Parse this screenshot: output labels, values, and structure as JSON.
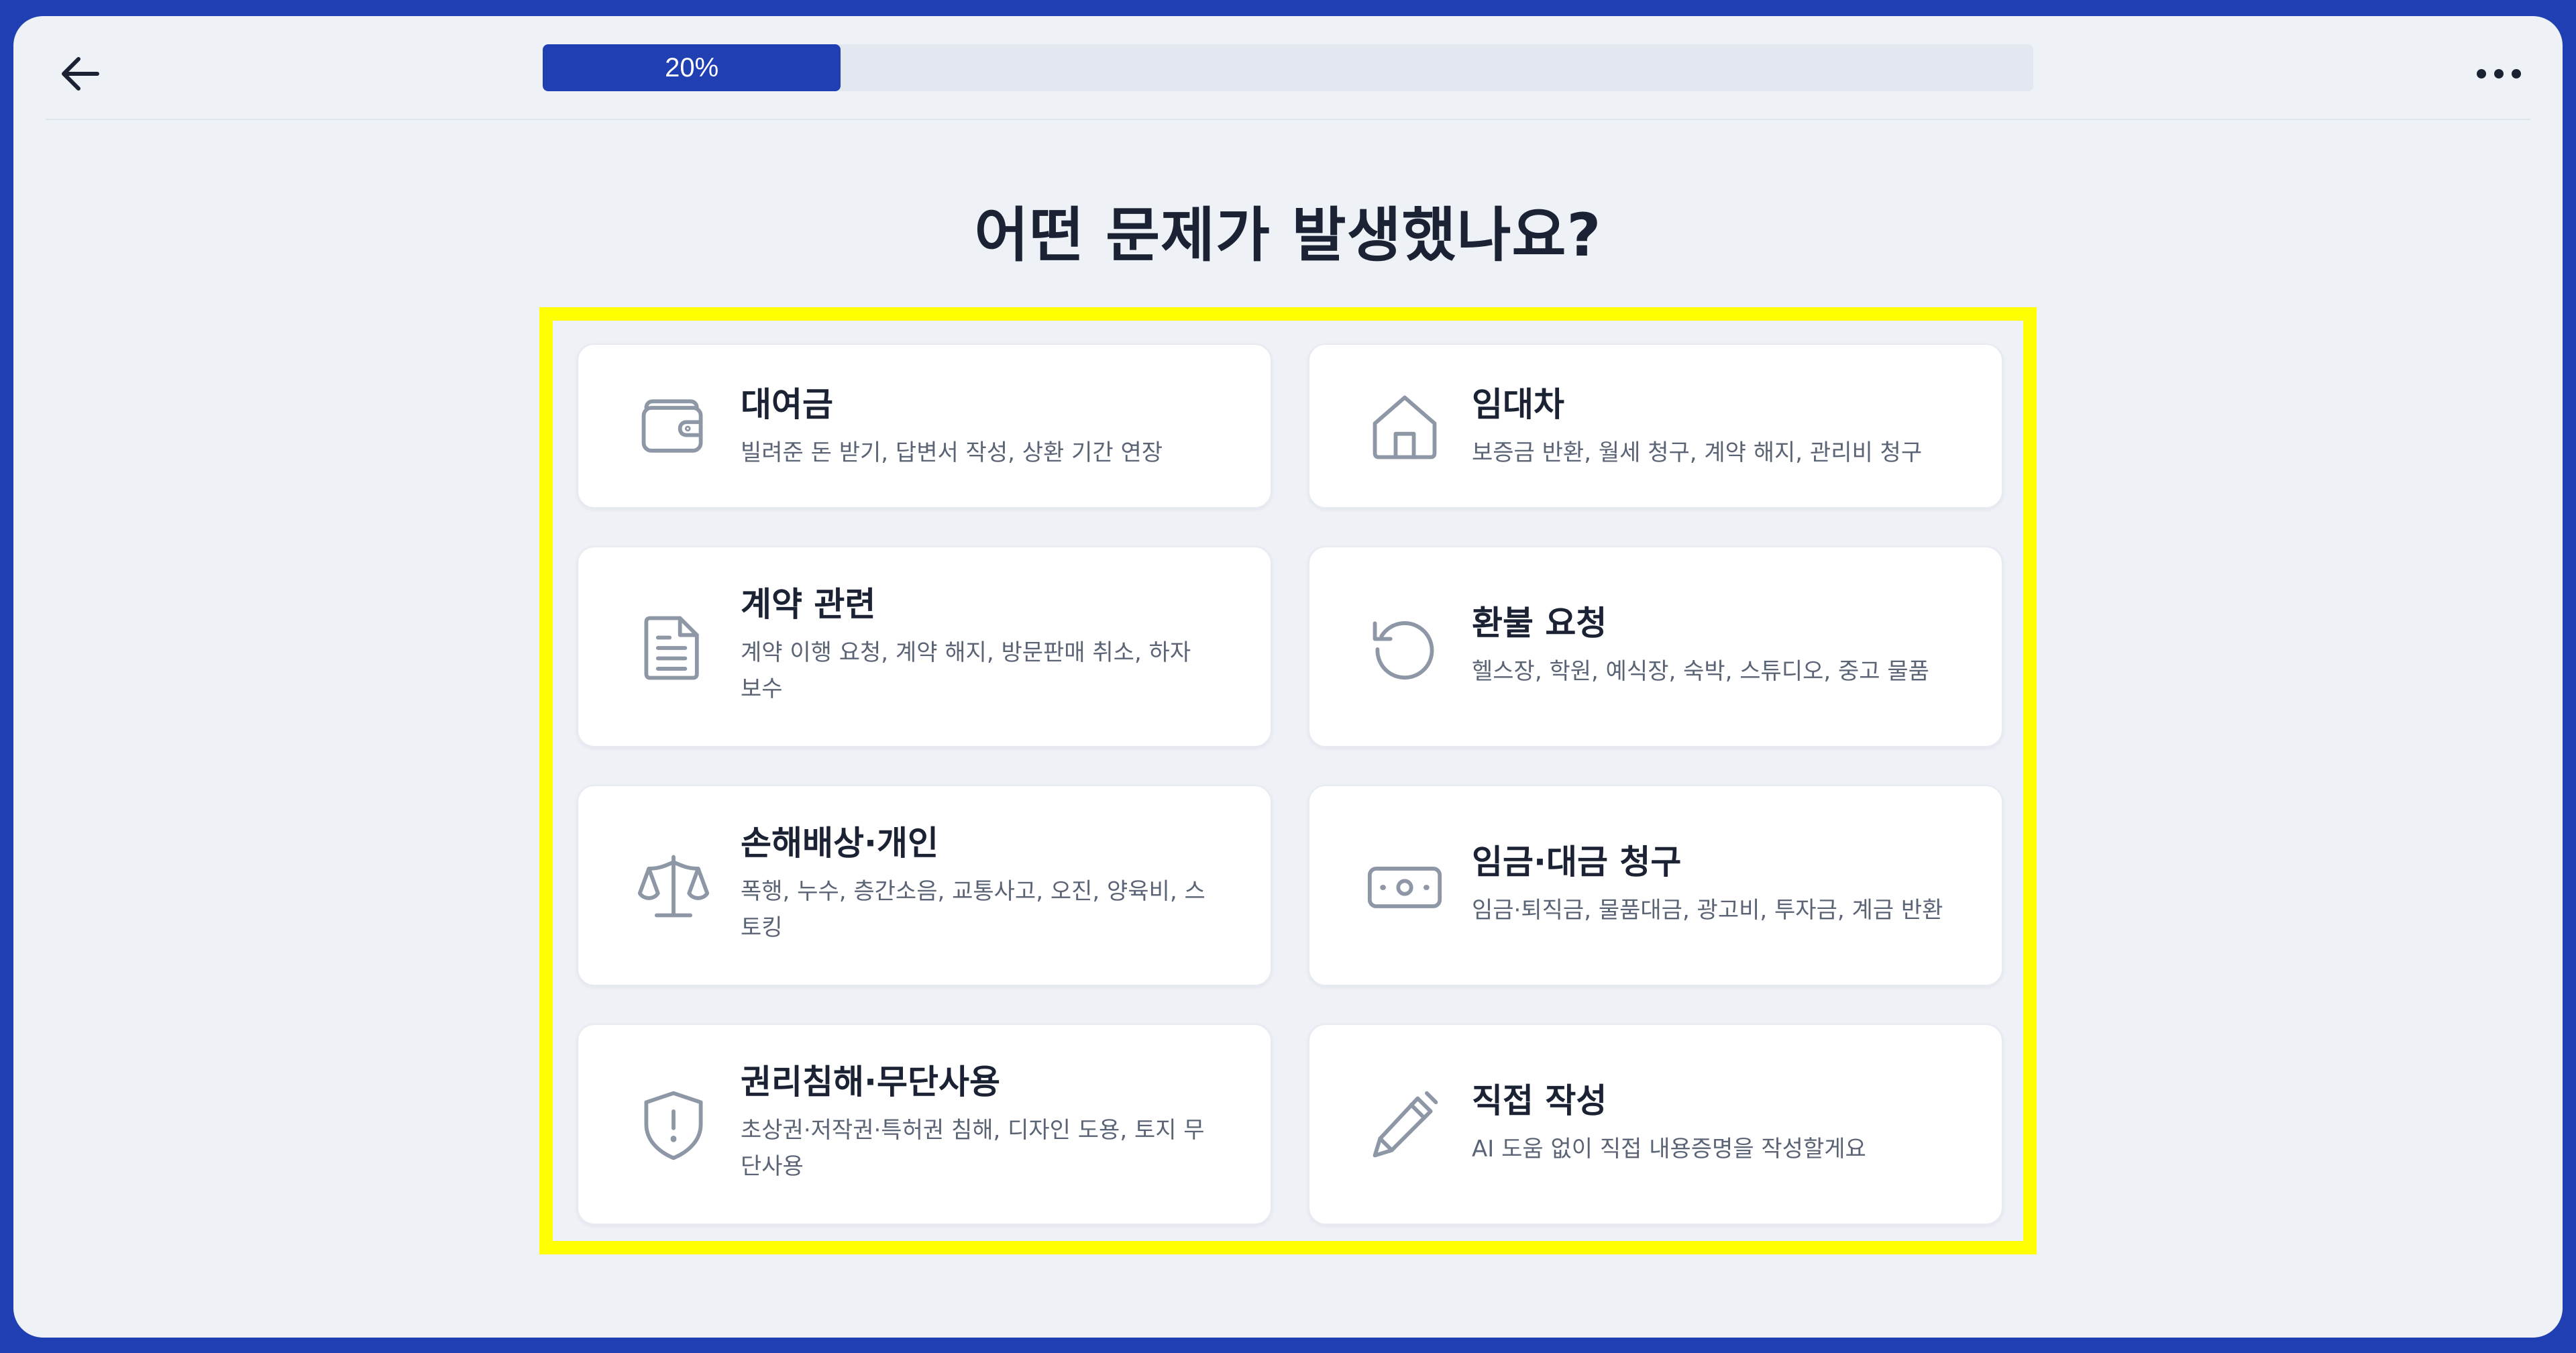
{
  "progress": {
    "label": "20%",
    "fraction": 0.2
  },
  "header": {
    "back_icon": "arrow-left-icon",
    "more_icon": "more-horizontal-icon"
  },
  "page": {
    "title": "어떤 문제가 발생했나요?"
  },
  "colors": {
    "accent": "#1f3fb2",
    "highlight_border": "#ffff00",
    "icon_stroke": "#8e97a6",
    "background": "#eef2f7"
  },
  "categories": [
    {
      "title": "대여금",
      "desc": "빌려준 돈 받기, 답변서 작성, 상환 기간 연장",
      "icon": "wallet-icon"
    },
    {
      "title": "임대차",
      "desc": "보증금 반환, 월세 청구, 계약 해지, 관리비 청구",
      "icon": "house-icon"
    },
    {
      "title": "계약 관련",
      "desc": "계약 이행 요청, 계약 해지, 방문판매 취소, 하자 보수",
      "icon": "document-icon"
    },
    {
      "title": "환불 요청",
      "desc": "헬스장, 학원, 예식장, 숙박, 스튜디오, 중고 물품",
      "icon": "refresh-icon"
    },
    {
      "title": "손해배상·개인",
      "desc": "폭행, 누수, 층간소음, 교통사고, 오진, 양육비, 스토킹",
      "icon": "scales-icon"
    },
    {
      "title": "임금·대금 청구",
      "desc": "임금·퇴직금, 물품대금, 광고비, 투자금, 계금 반환",
      "icon": "banknote-icon"
    },
    {
      "title": "권리침해·무단사용",
      "desc": "초상권·저작권·특허권 침해, 디자인 도용, 토지 무단사용",
      "icon": "shield-alert-icon"
    },
    {
      "title": "직접 작성",
      "desc": "AI 도움 없이 직접 내용증명을 작성할게요",
      "icon": "pencil-icon"
    }
  ]
}
